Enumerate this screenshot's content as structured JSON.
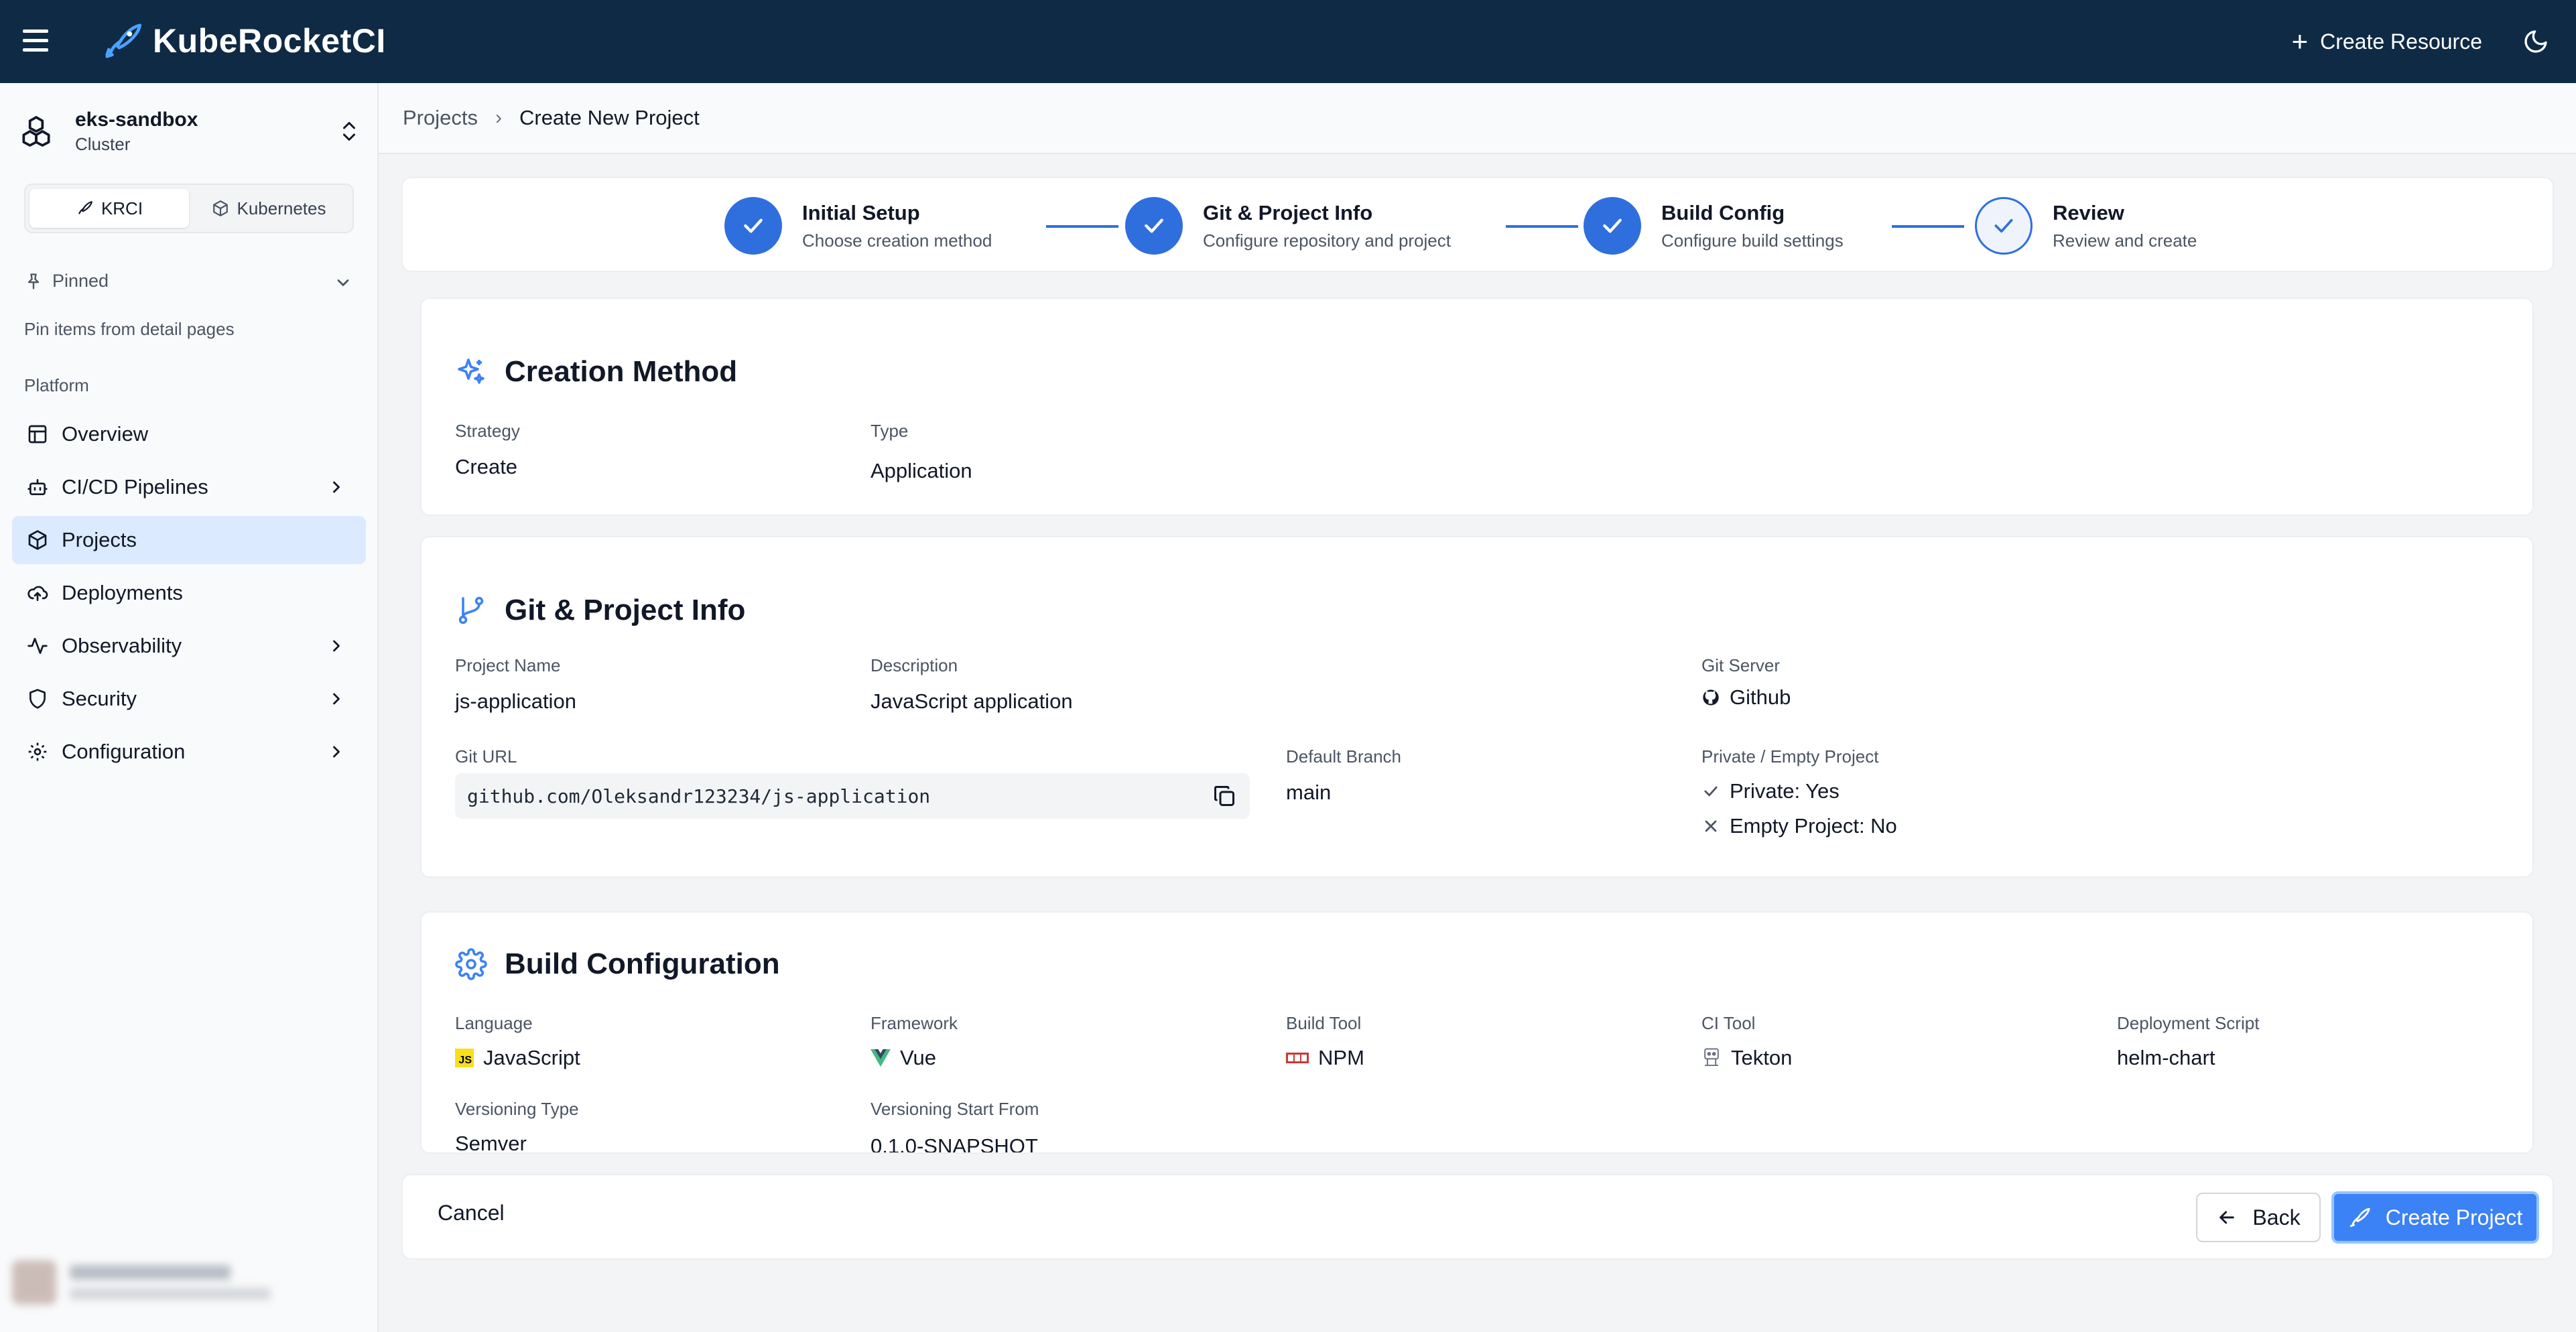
{
  "app": {
    "title": "KubeRocketCI",
    "create_resource": "Create Resource"
  },
  "sidebar": {
    "cluster_name": "eks-sandbox",
    "cluster_sub": "Cluster",
    "modes": [
      "KRCI",
      "Kubernetes"
    ],
    "pinned_label": "Pinned",
    "pinned_hint": "Pin items from detail pages",
    "platform_label": "Platform",
    "items": [
      {
        "label": "Overview",
        "icon": "layout-icon"
      },
      {
        "label": "CI/CD Pipelines",
        "icon": "bot-icon"
      },
      {
        "label": "Projects",
        "icon": "box-icon"
      },
      {
        "label": "Deployments",
        "icon": "cloud-upload-icon"
      },
      {
        "label": "Observability",
        "icon": "activity-icon"
      },
      {
        "label": "Security",
        "icon": "shield-icon"
      },
      {
        "label": "Configuration",
        "icon": "gear-icon"
      }
    ]
  },
  "breadcrumb": {
    "parent": "Projects",
    "current": "Create New Project"
  },
  "steps": [
    {
      "title": "Initial Setup",
      "desc": "Choose creation method"
    },
    {
      "title": "Git & Project Info",
      "desc": "Configure repository and project"
    },
    {
      "title": "Build Config",
      "desc": "Configure build settings"
    },
    {
      "title": "Review",
      "desc": "Review and create"
    }
  ],
  "creation_method": {
    "title": "Creation Method",
    "strategy_label": "Strategy",
    "strategy": "Create",
    "type_label": "Type",
    "type": "Application"
  },
  "git_info": {
    "title": "Git & Project Info",
    "project_name_label": "Project Name",
    "project_name": "js-application",
    "description_label": "Description",
    "description": "JavaScript application",
    "git_server_label": "Git Server",
    "git_server": "Github",
    "git_url_label": "Git URL",
    "git_url": "github.com/Oleksandr123234/js-application",
    "default_branch_label": "Default Branch",
    "default_branch": "main",
    "private_label": "Private / Empty Project",
    "private_value": "Private: Yes",
    "empty_value": "Empty Project: No"
  },
  "build_config": {
    "title": "Build Configuration",
    "language_label": "Language",
    "language": "JavaScript",
    "framework_label": "Framework",
    "framework": "Vue",
    "build_tool_label": "Build Tool",
    "build_tool": "NPM",
    "ci_tool_label": "CI Tool",
    "ci_tool": "Tekton",
    "deploy_script_label": "Deployment Script",
    "deploy_script": "helm-chart",
    "versioning_type_label": "Versioning Type",
    "versioning_type": "Semver",
    "versioning_start_label": "Versioning Start From",
    "versioning_start": "0.1.0-SNAPSHOT"
  },
  "footer": {
    "cancel": "Cancel",
    "back": "Back",
    "create": "Create Project"
  },
  "colors": {
    "topbar": "#0f2a45",
    "accent": "#2f6fdd",
    "active_nav": "#dbeafe"
  }
}
